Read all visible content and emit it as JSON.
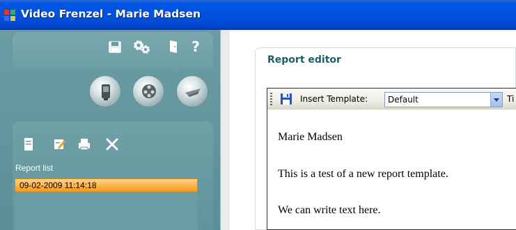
{
  "window": {
    "title": "Video Frenzel - Marie Madsen"
  },
  "left_toolbar": {
    "icons": [
      "save-icon",
      "settings-icon",
      "exit-door-icon",
      "help-icon"
    ],
    "help_glyph": "?"
  },
  "mode_buttons": [
    "camera-icon",
    "film-reel-icon",
    "rotation-chair-icon"
  ],
  "reports": {
    "actions": [
      "new-report-icon",
      "edit-report-icon",
      "print-icon",
      "delete-icon"
    ],
    "list_label": "Report list",
    "items": [
      "09-02-2009 11:14:18"
    ],
    "selected_index": 0
  },
  "editor": {
    "title": "Report editor",
    "toolbar": {
      "insert_label": "Insert Template:",
      "template_value": "Default",
      "trailing_label": "Ti"
    },
    "document_lines": [
      "Marie Madsen",
      "This is a test of a new report template.",
      "We can write text here."
    ]
  },
  "colors": {
    "title_bar": "#0152df",
    "panel_teal": "#5a8f97",
    "selected_row": "#ffb64a",
    "editor_title": "#1d5f66"
  }
}
